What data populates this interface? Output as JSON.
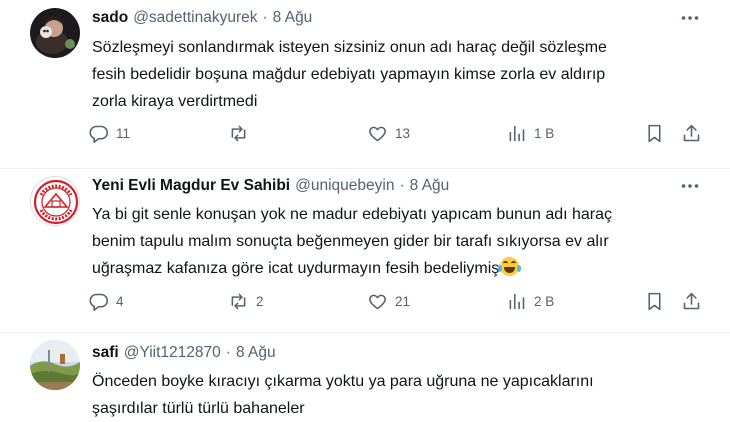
{
  "tweets": [
    {
      "name": "sado",
      "handle": "@sadettinakyurek",
      "dot": "·",
      "time": "8 Ağu",
      "lines": [
        "Sözleşmeyi sonlandırmak isteyen sizsiniz onun adı haraç değil sözleşme",
        "fesih bedelidir boşuna mağdur edebiyatı yapmayın kimse zorla ev aldırıp",
        "zorla kiraya verdirtmedi"
      ],
      "replies": "11",
      "reposts": "",
      "likes": "13",
      "views": "1 B"
    },
    {
      "name": "Yeni Evli Magdur Ev Sahibi",
      "handle": "@uniquebeyin",
      "dot": "·",
      "time": "8 Ağu",
      "lines": [
        "Ya bi git senle konuşan yok ne madur edebiyatı yapıcam bunun adı haraç",
        "benim tapulu malım sonuçta beğenmeyen gider bir tarafı sıkıyorsa ev alır",
        "uğraşmaz kafanıza göre icat uydurmayın fesih bedeliymiş"
      ],
      "replies": "4",
      "reposts": "2",
      "likes": "21",
      "views": "2 B"
    },
    {
      "name": "safi",
      "handle": "@Yiit1212870",
      "dot": "·",
      "time": "8 Ağu",
      "lines": [
        "Önceden boyke kıracıyı çıkarma yoktu ya para uğruna ne yapıcaklarını",
        "şaşırdılar türlü türlü bahaneler"
      ]
    }
  ],
  "icons": {
    "more": "more-dots-icon",
    "reply": "reply-icon",
    "repost": "repost-icon",
    "like": "heart-icon",
    "views": "views-icon",
    "bookmark": "bookmark-icon",
    "share": "share-icon",
    "emoji": "laughing-tears-emoji"
  },
  "colors": {
    "text": "#0f1419",
    "secondary": "#536471",
    "divider": "#eff3f4"
  }
}
